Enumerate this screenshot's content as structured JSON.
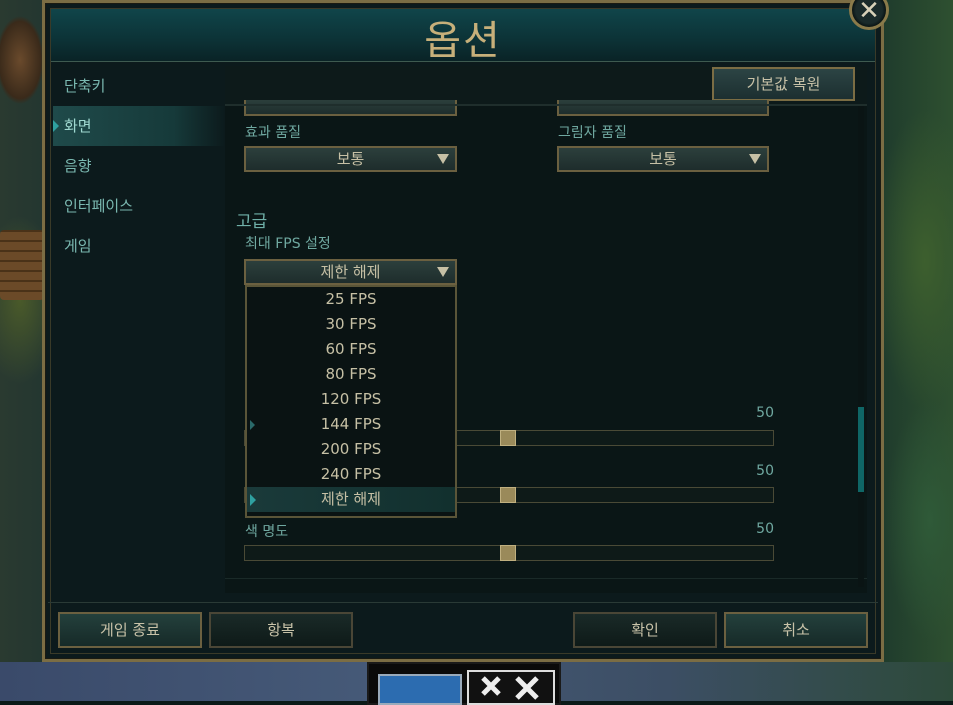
{
  "dialog": {
    "title": "옵션",
    "close_glyph": "✕"
  },
  "sidebar": {
    "items": [
      {
        "label": "단축키"
      },
      {
        "label": "화면"
      },
      {
        "label": "음향"
      },
      {
        "label": "인터페이스"
      },
      {
        "label": "게임"
      }
    ]
  },
  "content": {
    "reset_label": "기본값 복원",
    "effects_quality": {
      "label": "효과 품질",
      "value": "보통"
    },
    "shadow_quality": {
      "label": "그림자 품질",
      "value": "보통"
    },
    "advanced_section": "고급",
    "max_fps": {
      "label": "최대 FPS 설정",
      "value": "제한 해제"
    },
    "fps_options": [
      "25 FPS",
      "30 FPS",
      "60 FPS",
      "80 FPS",
      "120 FPS",
      "144 FPS",
      "200 FPS",
      "240 FPS",
      "제한 해제"
    ],
    "sliders": [
      {
        "label": "",
        "value": "50"
      },
      {
        "label": "",
        "value": "50"
      },
      {
        "label": "색 명도",
        "value": "50"
      }
    ]
  },
  "footer": {
    "exit_game": "게임 종료",
    "surrender": "항복",
    "confirm": "확인",
    "cancel": "취소"
  },
  "colors": {
    "accent": "#2fa0a0",
    "gold_border": "#7b6d44",
    "title_text": "#c7b07a"
  }
}
